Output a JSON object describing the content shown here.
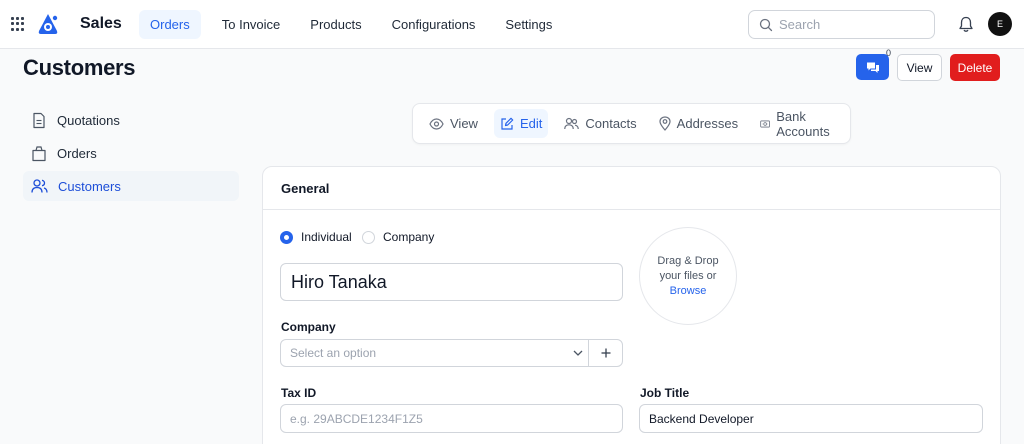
{
  "app": {
    "title": "Sales",
    "logo": "app-logo-icon"
  },
  "nav": [
    {
      "label": "Orders",
      "active": true
    },
    {
      "label": "To Invoice"
    },
    {
      "label": "Products"
    },
    {
      "label": "Configurations"
    },
    {
      "label": "Settings"
    }
  ],
  "search": {
    "placeholder": "Search"
  },
  "user": {
    "initial": "E"
  },
  "page": {
    "title": "Customers"
  },
  "actions": {
    "chat_count": "0",
    "view_label": "View",
    "delete_label": "Delete"
  },
  "sidebar": [
    {
      "label": "Quotations",
      "icon": "document-icon"
    },
    {
      "label": "Orders",
      "icon": "bag-icon"
    },
    {
      "label": "Customers",
      "icon": "users-icon",
      "active": true
    }
  ],
  "tabs": [
    {
      "label": "View",
      "icon": "eye-icon"
    },
    {
      "label": "Edit",
      "icon": "edit-icon",
      "active": true
    },
    {
      "label": "Contacts",
      "icon": "users-icon"
    },
    {
      "label": "Addresses",
      "icon": "map-pin-icon"
    },
    {
      "label": "Bank Accounts",
      "icon": "bank-icon"
    }
  ],
  "form": {
    "section_title": "General",
    "type_options": [
      "Individual",
      "Company"
    ],
    "type_selected": "Individual",
    "name_value": "Hiro Tanaka",
    "upload": {
      "line1": "Drag & Drop",
      "line2": "your files or",
      "browse": "Browse"
    },
    "company_label": "Company",
    "company_placeholder": "Select an option",
    "tax_label": "Tax ID",
    "tax_placeholder": "e.g. 29ABCDE1234F1Z5",
    "job_label": "Job Title",
    "job_value": "Backend Developer"
  },
  "colors": {
    "accent": "#2563eb",
    "danger": "#e11d1d"
  }
}
